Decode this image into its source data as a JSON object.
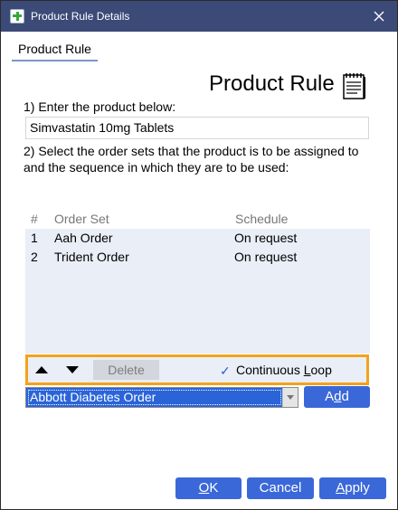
{
  "window": {
    "title": "Product Rule Details"
  },
  "tab": {
    "label": "Product Rule"
  },
  "heading": {
    "title": "Product Rule"
  },
  "step1": {
    "label": "1) Enter the product below:",
    "product_value": "Simvastatin 10mg Tablets"
  },
  "step2": {
    "line1": "2) Select the order sets that the product is to be assigned to",
    "line2": "and the sequence in which they are to be used:"
  },
  "grid": {
    "columns": {
      "num": "#",
      "order_set": "Order Set",
      "schedule": "Schedule"
    },
    "rows": [
      {
        "num": "1",
        "order_set": "Aah Order",
        "schedule": "On request"
      },
      {
        "num": "2",
        "order_set": "Trident Order",
        "schedule": "On request"
      }
    ]
  },
  "toolbar": {
    "delete_label": "Delete",
    "continuous_loop_pre": "Continuous ",
    "continuous_loop_key": "L",
    "continuous_loop_post": "oop",
    "continuous_loop_checked": true
  },
  "order_select": {
    "selected": "Abbott Diabetes Order"
  },
  "add_button": {
    "pre": "A",
    "key": "d",
    "post": "d"
  },
  "footer": {
    "ok": {
      "key": "O",
      "post": "K"
    },
    "cancel": "Cancel",
    "apply": {
      "key": "A",
      "post": "pply"
    }
  },
  "colors": {
    "titlebar": "#3c4a78",
    "accent_button": "#3b68d8",
    "grid_background": "#e9eef7",
    "highlight_border": "#f4a21a"
  },
  "icons": [
    "app-icon",
    "close-icon",
    "notepad-icon",
    "move-up-icon",
    "move-down-icon",
    "checkmark-icon",
    "dropdown-arrow-icon"
  ]
}
